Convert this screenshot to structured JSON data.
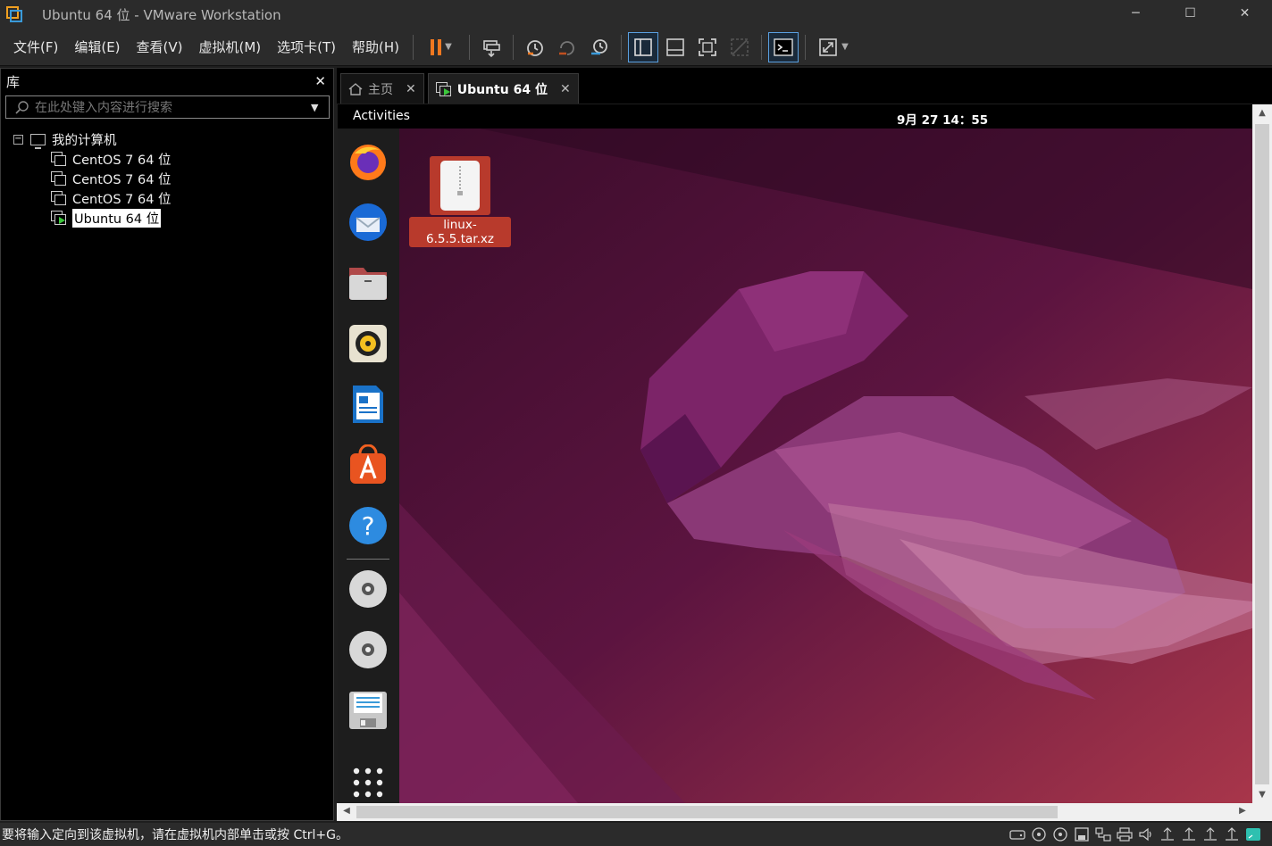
{
  "window": {
    "title": "Ubuntu 64 位 - VMware Workstation",
    "minimize": "─",
    "maximize": "☐",
    "close": "✕"
  },
  "menu": {
    "items": [
      "文件(F)",
      "编辑(E)",
      "查看(V)",
      "虚拟机(M)",
      "选项卡(T)",
      "帮助(H)"
    ]
  },
  "toolbar": {
    "icons": [
      "pause-icon",
      "send-ctrl-alt-del-icon",
      "snapshot-icon",
      "revert-snapshot-icon",
      "snapshot-manager-icon",
      "show-library-icon",
      "thumbnail-bar-icon",
      "full-screen-icon",
      "unity-icon",
      "console-view-icon",
      "stretch-guest-icon"
    ]
  },
  "library": {
    "title": "库",
    "close": "✕",
    "search_placeholder": "在此处键入内容进行搜索",
    "root_expander": "−",
    "root_label": "我的计算机",
    "vms": [
      {
        "label": "CentOS 7 64 位",
        "running": false
      },
      {
        "label": "CentOS 7 64 位",
        "running": false
      },
      {
        "label": "CentOS 7 64 位",
        "running": false
      },
      {
        "label": "Ubuntu 64 位",
        "running": true,
        "selected": true
      }
    ]
  },
  "tabs": [
    {
      "label": "主页",
      "close": "✕"
    },
    {
      "label": "Ubuntu 64 位",
      "close": "✕",
      "active": true
    }
  ],
  "guest": {
    "activities": "Activities",
    "clock": "9月 27  14：55",
    "dock_icons": [
      "firefox-icon",
      "thunderbird-icon",
      "files-icon",
      "rhythmbox-icon",
      "libreoffice-writer-icon",
      "app-center-icon",
      "help-icon",
      "dvd-icon",
      "dvd-icon",
      "floppy-icon",
      "show-apps-icon"
    ],
    "desktop_file": "linux-6.5.5.tar.xz"
  },
  "status": {
    "text": "要将输入定向到该虚拟机，请在虚拟机内部单击或按 Ctrl+G。"
  },
  "colors": {
    "pause_accent": "#f07820",
    "selection_running": "#3cc83c",
    "wallpaper_base": "#4a0e33",
    "desktop_file_highlight": "#b83a2c"
  }
}
